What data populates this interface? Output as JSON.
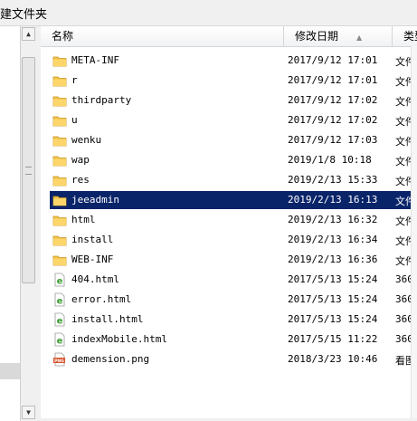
{
  "toolbar": {
    "new_folder_label": "建文件夹"
  },
  "header": {
    "name": "名称",
    "modified": "修改日期",
    "type": "类型"
  },
  "files": [
    {
      "name": "META-INF",
      "date": "2017/9/12 17:01",
      "type": "文件",
      "icon": "folder-icon"
    },
    {
      "name": "r",
      "date": "2017/9/12 17:01",
      "type": "文件",
      "icon": "folder-icon"
    },
    {
      "name": "thirdparty",
      "date": "2017/9/12 17:02",
      "type": "文件",
      "icon": "folder-icon"
    },
    {
      "name": "u",
      "date": "2017/9/12 17:02",
      "type": "文件",
      "icon": "folder-icon"
    },
    {
      "name": "wenku",
      "date": "2017/9/12 17:03",
      "type": "文件",
      "icon": "folder-icon"
    },
    {
      "name": "wap",
      "date": "2019/1/8 10:18",
      "type": "文件",
      "icon": "folder-icon"
    },
    {
      "name": "res",
      "date": "2019/2/13 15:33",
      "type": "文件",
      "icon": "folder-icon"
    },
    {
      "name": "jeeadmin",
      "date": "2019/2/13 16:13",
      "type": "文件",
      "icon": "folder-icon",
      "selected": true
    },
    {
      "name": "html",
      "date": "2019/2/13 16:32",
      "type": "文件",
      "icon": "folder-icon"
    },
    {
      "name": "install",
      "date": "2019/2/13 16:34",
      "type": "文件",
      "icon": "folder-icon"
    },
    {
      "name": "WEB-INF",
      "date": "2019/2/13 16:36",
      "type": "文件",
      "icon": "folder-icon"
    },
    {
      "name": "404.html",
      "date": "2017/5/13 15:24",
      "type": "360",
      "icon": "html-file-icon"
    },
    {
      "name": "error.html",
      "date": "2017/5/13 15:24",
      "type": "360",
      "icon": "html-file-icon"
    },
    {
      "name": "install.html",
      "date": "2017/5/13 15:24",
      "type": "360",
      "icon": "html-file-icon"
    },
    {
      "name": "indexMobile.html",
      "date": "2017/5/15 11:22",
      "type": "360",
      "icon": "html-file-icon"
    },
    {
      "name": "demension.png",
      "date": "2018/3/23 10:46",
      "type": "看图",
      "icon": "png-file-icon"
    }
  ],
  "colors": {
    "selection": "#0a246a",
    "folder": "#f2c34a",
    "html_icon": "#3a9c2e",
    "png_icon": "#d9532c"
  }
}
